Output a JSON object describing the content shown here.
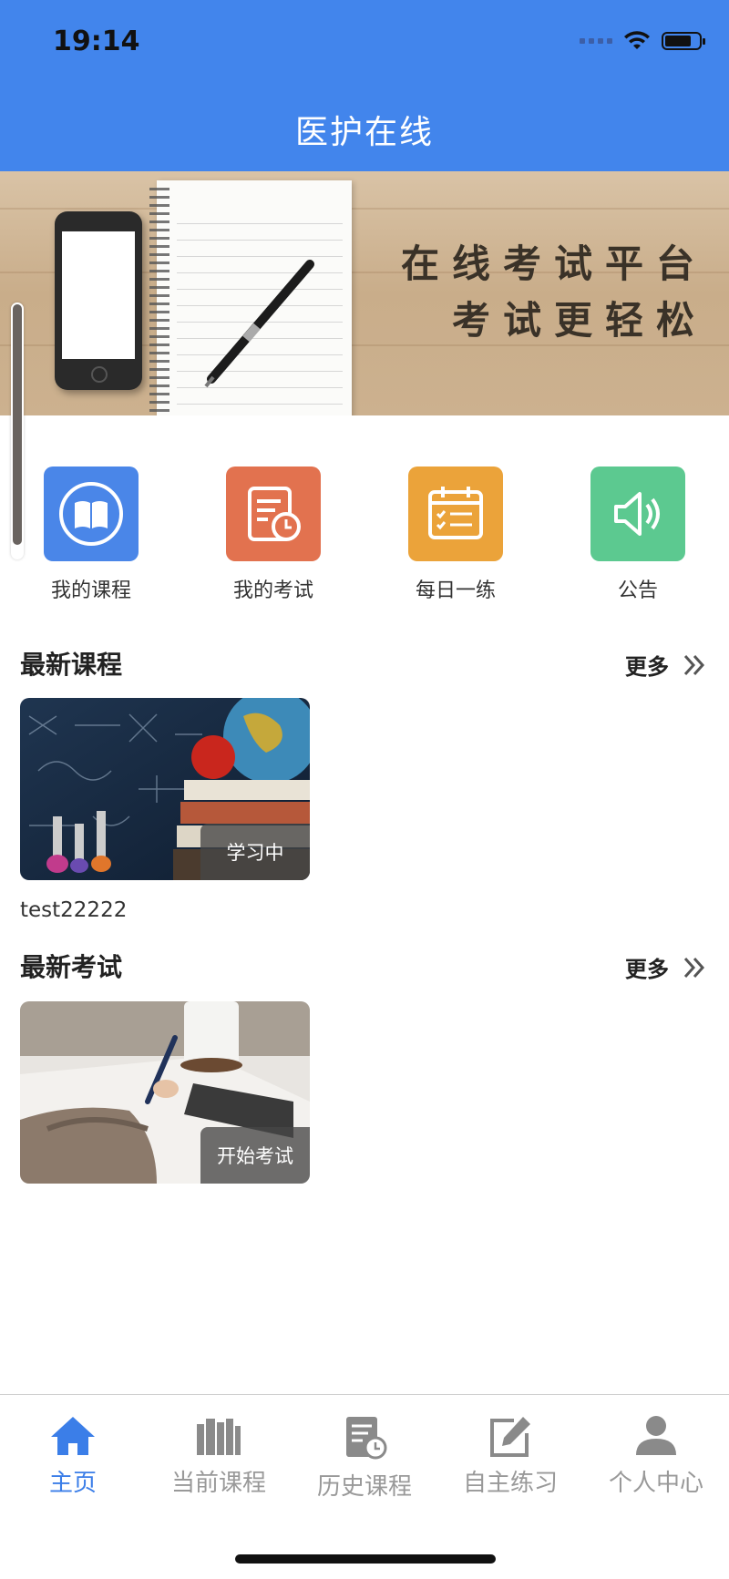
{
  "status_bar": {
    "time": "19:14"
  },
  "header": {
    "title": "医护在线"
  },
  "banner": {
    "line1": "在线考试平台",
    "line2": "考试更轻松"
  },
  "quick_menu": [
    {
      "label": "我的课程",
      "icon": "book-icon",
      "color": "#4a86e8"
    },
    {
      "label": "我的考试",
      "icon": "exam-clock-icon",
      "color": "#e2724f"
    },
    {
      "label": "每日一练",
      "icon": "calendar-list-icon",
      "color": "#eba33a"
    },
    {
      "label": "公告",
      "icon": "speaker-icon",
      "color": "#5cc990"
    }
  ],
  "latest_courses": {
    "title": "最新课程",
    "more": "更多",
    "items": [
      {
        "name": "test22222",
        "badge": "学习中"
      }
    ]
  },
  "latest_exams": {
    "title": "最新考试",
    "more": "更多",
    "items": [
      {
        "badge": "开始考试"
      }
    ]
  },
  "tabbar": [
    {
      "label": "主页",
      "icon": "home-icon",
      "active": true
    },
    {
      "label": "当前课程",
      "icon": "books-icon",
      "active": false
    },
    {
      "label": "历史课程",
      "icon": "history-doc-icon",
      "active": false
    },
    {
      "label": "自主练习",
      "icon": "edit-icon",
      "active": false
    },
    {
      "label": "个人中心",
      "icon": "user-icon",
      "active": false
    }
  ],
  "colors": {
    "primary": "#4285ec",
    "tab_active": "#3b7ee8",
    "tab_inactive": "#999999"
  }
}
